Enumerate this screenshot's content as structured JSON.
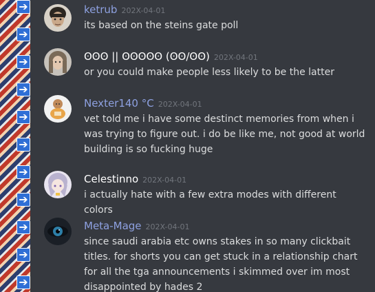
{
  "colors": {
    "background": "#36393f",
    "username_blue": "#9fb4ff",
    "username_white": "#ffffff",
    "timestamp": "#72767d",
    "text": "#dcddde"
  },
  "left_strip": {
    "icon": "arrow-right-icon",
    "glyph": "➔"
  },
  "messages": [
    {
      "username": "ketrub",
      "timestamp": "202X-04-01",
      "text": "its based on the steins gate poll",
      "avatar_icon": "avatar-face-icon"
    },
    {
      "username": "ʘʘʘ || ʘʘʘʘʘ (ʘʘ/ʘʘ)",
      "timestamp": "202X-04-01",
      "text": "or you could make people less likely to be the latter",
      "avatar_icon": "avatar-face-icon"
    },
    {
      "username": "Nexter140 °C",
      "timestamp": "202X-04-01",
      "text": "vet told me i have some destinct memories from when i was trying to figure out. i do be like me, not good at world building is so fucking huge",
      "avatar_icon": "avatar-face-icon"
    },
    {
      "username": "Celestinno",
      "timestamp": "202X-04-01",
      "text": "i actually hate with a few extra modes with different colors",
      "avatar_icon": "avatar-face-icon"
    },
    {
      "username": "Meta-Mage",
      "timestamp": "202X-04-01",
      "text": "since saudi arabia etc owns stakes in so many clickbait titles. for shorts you can get stuck in a relationship chart for all the tga announcements i skimmed over im most disappointed by hades 2",
      "avatar_icon": "avatar-eye-icon"
    }
  ]
}
